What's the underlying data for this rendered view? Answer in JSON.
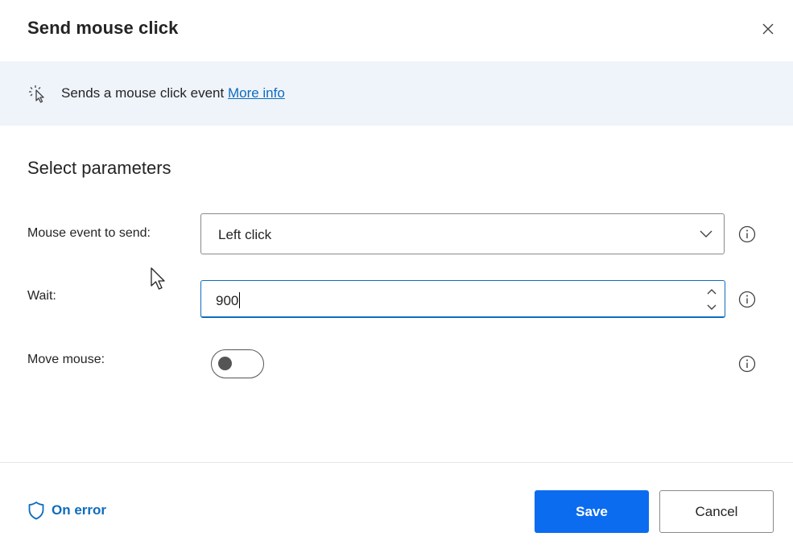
{
  "dialog": {
    "title": "Send mouse click",
    "close_icon": "close-icon"
  },
  "banner": {
    "icon": "mouse-click-icon",
    "text": "Sends a mouse click event ",
    "link": "More info"
  },
  "section_title": "Select parameters",
  "fields": {
    "mouse_event": {
      "label": "Mouse event to send:",
      "value": "Left click"
    },
    "wait": {
      "label": "Wait:",
      "value": "900"
    },
    "move_mouse": {
      "label": "Move mouse:",
      "on": false
    }
  },
  "footer": {
    "on_error": "On error",
    "save": "Save",
    "cancel": "Cancel"
  },
  "colors": {
    "accent": "#0f6cbd",
    "primary_button": "#0b6cf0",
    "banner_bg": "#eff4fb"
  }
}
